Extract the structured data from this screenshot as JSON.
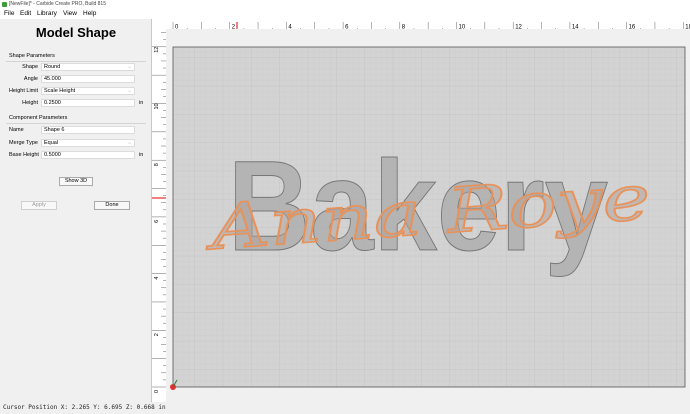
{
  "window": {
    "title": "[NewFile]* - Carbide Create PRO, Build 815"
  },
  "menu": {
    "file": "File",
    "edit": "Edit",
    "library": "Library",
    "view": "View",
    "help": "Help"
  },
  "panel": {
    "title": "Model Shape",
    "shape_params": {
      "heading": "Shape Parameters",
      "shape_label": "Shape",
      "shape_value": "Round",
      "angle_label": "Angle",
      "angle_value": "45.000",
      "height_limit_label": "Height Limit",
      "height_limit_value": "Scale Height",
      "height_label": "Height",
      "height_value": "0.2500",
      "height_unit": "in"
    },
    "component_params": {
      "heading": "Component Parameters",
      "name_label": "Name",
      "name_value": "Shape 6",
      "merge_label": "Merge Type",
      "merge_value": "Equal",
      "base_height_label": "Base Height",
      "base_height_value": "0.5000",
      "base_height_unit": "in"
    },
    "show3d_label": "Show 3D",
    "apply_label": "Apply",
    "done_label": "Done"
  },
  "ruler_x_labels": [
    "0",
    "2",
    "4",
    "6",
    "8",
    "10",
    "12",
    "14",
    "16",
    "18"
  ],
  "ruler_y_labels": [
    "12",
    "10",
    "8",
    "6",
    "4",
    "2",
    "0"
  ],
  "artwork": {
    "main_text": "Bakery",
    "script_text": "Anna Roye"
  },
  "colors": {
    "script_stroke": "#e8925a",
    "accent_marker": "#e03030",
    "bed": "#d3d3d3"
  },
  "status": {
    "text": "Cursor Position X: 2.265 Y: 6.695 Z: 0.668 in"
  }
}
